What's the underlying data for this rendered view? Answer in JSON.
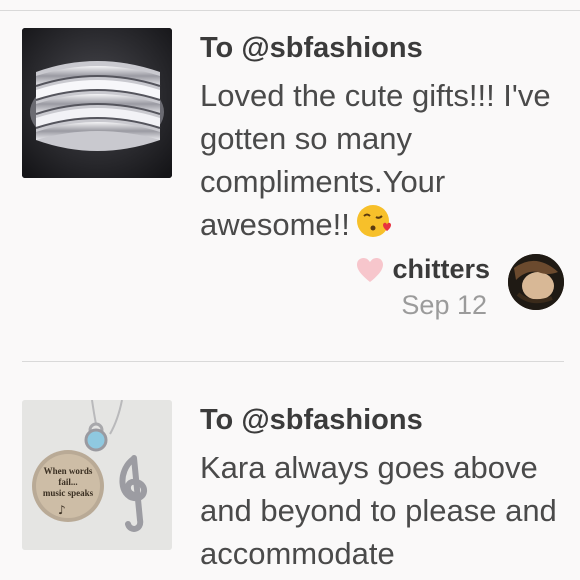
{
  "reviews": [
    {
      "recipient_prefix": "To ",
      "recipient": "@sbfashions",
      "text": "Loved the cute gifts!!! I've gotten so many compliments.Your awesome!!",
      "emoji": "kissing-face-heart-emoji",
      "reviewer": "chitters",
      "date": "Sep 12",
      "product_icon": "ring-product-photo",
      "like_color": "#f7c6cc"
    },
    {
      "recipient_prefix": "To ",
      "recipient": "@sbfashions",
      "text": "Kara always goes above and beyond to please and accommodate",
      "product_icon": "music-necklace-product-photo",
      "pendant_text": "When words fail... music speaks"
    }
  ]
}
